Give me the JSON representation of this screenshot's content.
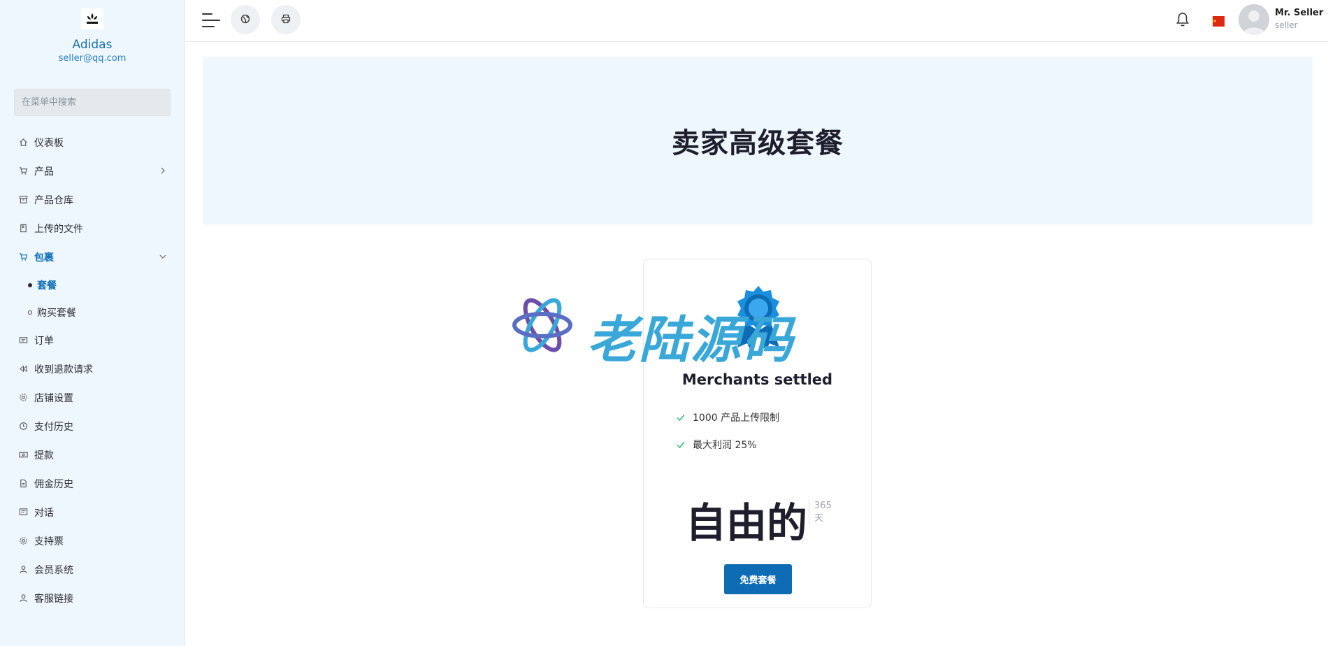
{
  "brand": {
    "name": "Adidas",
    "email": "seller@qq.com",
    "logo_text": "adidas"
  },
  "search": {
    "placeholder": "在菜单中搜索"
  },
  "sidebar": {
    "items": [
      {
        "label": "仪表板",
        "icon": "home-icon"
      },
      {
        "label": "产品",
        "icon": "cart-icon",
        "has_children": true
      },
      {
        "label": "产品仓库",
        "icon": "archive-icon"
      },
      {
        "label": "上传的文件",
        "icon": "folder-icon"
      },
      {
        "label": "包裹",
        "icon": "cart-icon",
        "active": true,
        "expanded": true
      },
      {
        "label": "订单",
        "icon": "receipt-icon"
      },
      {
        "label": "收到退款请求",
        "icon": "backward-icon"
      },
      {
        "label": "店铺设置",
        "icon": "gear-icon"
      },
      {
        "label": "支付历史",
        "icon": "history-icon"
      },
      {
        "label": "提款",
        "icon": "money-icon"
      },
      {
        "label": "佣金历史",
        "icon": "file-icon"
      },
      {
        "label": "对话",
        "icon": "chat-icon"
      },
      {
        "label": "支持票",
        "icon": "support-icon"
      },
      {
        "label": "会员系统",
        "icon": "user-icon"
      },
      {
        "label": "客服链接",
        "icon": "user-icon"
      }
    ],
    "sub_items": [
      {
        "label": "套餐",
        "active": true
      },
      {
        "label": "购买套餐",
        "active": false
      }
    ]
  },
  "header": {
    "user_name": "Mr. Seller",
    "user_role": "seller",
    "language_flag": "china-flag"
  },
  "hero": {
    "title": "卖家高级套餐"
  },
  "package": {
    "name": "Merchants settled",
    "features": [
      "1000 产品上传限制",
      "最大利润 25%"
    ],
    "price": "自由的",
    "duration_value": "365",
    "duration_unit": "天",
    "button_label": "免费套餐"
  },
  "watermark": {
    "text": "老陆源码"
  },
  "colors": {
    "accent": "#0e6cb5",
    "sidebar_bg": "#eef7fd",
    "watermark": "#3aa7d9"
  }
}
